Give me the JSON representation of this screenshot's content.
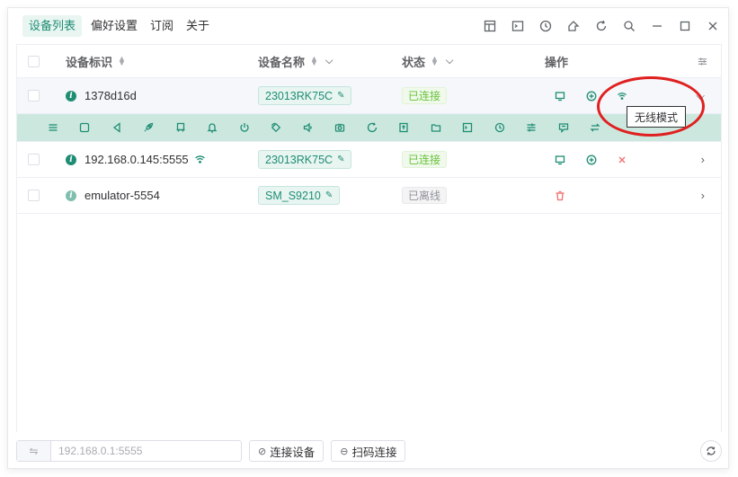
{
  "menu": {
    "items": [
      "设备列表",
      "偏好设置",
      "订阅",
      "关于"
    ],
    "active_index": 0
  },
  "window_icons": [
    "layout-icon",
    "terminal-icon",
    "clock-icon",
    "share-icon",
    "refresh-icon",
    "search-icon",
    "minimize-icon",
    "maximize-icon",
    "close-icon"
  ],
  "table": {
    "headers": {
      "device_id": "设备标识",
      "device_name": "设备名称",
      "status": "状态",
      "actions": "操作"
    },
    "rows": [
      {
        "id": "1378d16d",
        "name": "23013RK75C",
        "status": "已连接",
        "status_type": "ok",
        "wifi": false
      },
      {
        "id": "192.168.0.145:5555",
        "name": "23013RK75C",
        "status": "已连接",
        "status_type": "ok",
        "wifi": true
      },
      {
        "id": "emulator-5554",
        "name": "SM_S9210",
        "status": "已离线",
        "status_type": "off",
        "wifi": false
      }
    ]
  },
  "toolbar_icons": [
    "menu-icon",
    "home-icon",
    "back-icon",
    "rocket-icon",
    "screen-icon",
    "notification-icon",
    "power-icon",
    "rotate-icon",
    "volume-icon",
    "camera-icon",
    "reboot-icon",
    "upload-icon",
    "folder-icon",
    "shell-icon",
    "history-icon",
    "settings-icon",
    "message-icon",
    "switch-icon"
  ],
  "tooltip": {
    "text": "无线模式"
  },
  "bottom": {
    "address_placeholder": "192.168.0.1:5555",
    "connect_label": "连接设备",
    "scan_label": "扫码连接"
  },
  "colors": {
    "accent": "#1f8d74",
    "connected": "#67c23a",
    "danger": "#f56c6c",
    "highlight_ellipse": "#e02020"
  }
}
